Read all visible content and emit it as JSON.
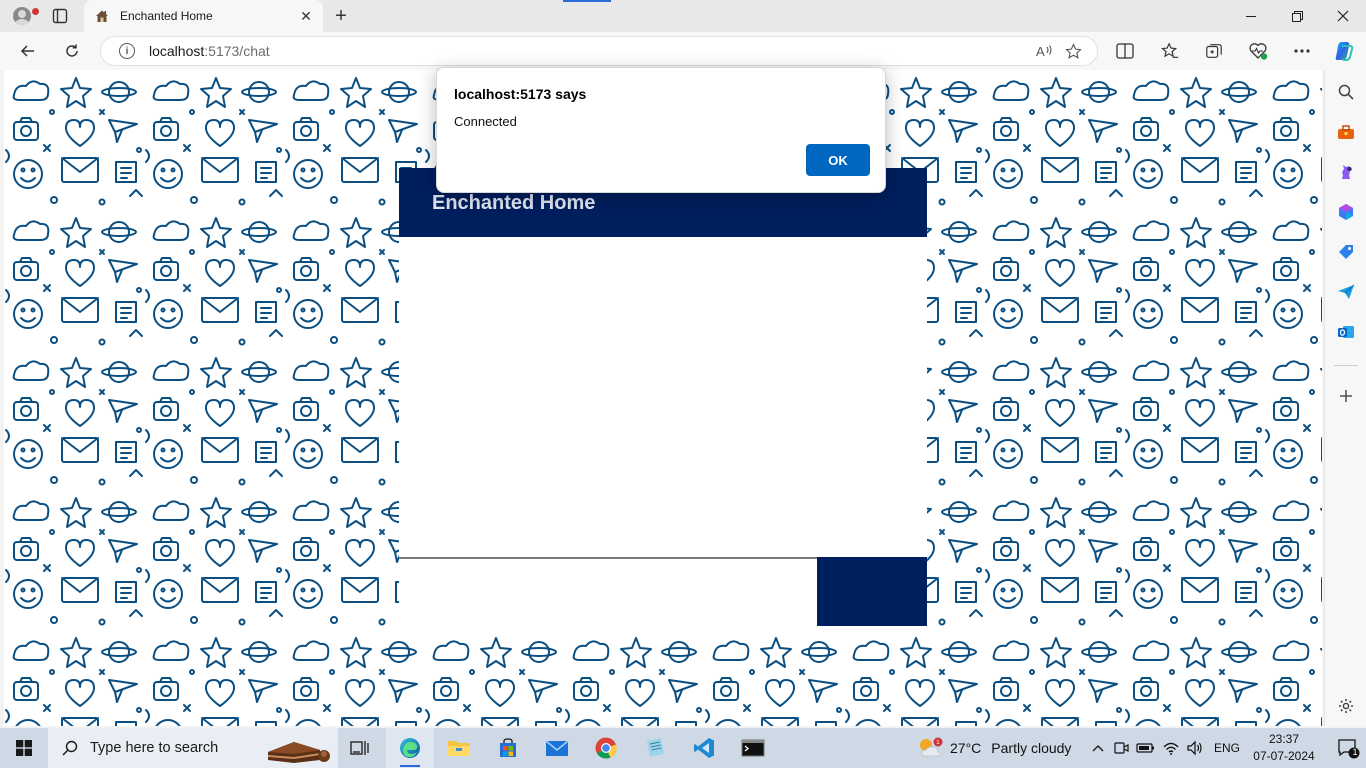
{
  "browser": {
    "tab_title": "Enchanted Home",
    "url_host": "localhost",
    "url_path": ":5173/chat"
  },
  "page": {
    "chat_title": "Enchanted Home"
  },
  "alert": {
    "title": "localhost:5173 says",
    "message": "Connected",
    "ok_label": "OK"
  },
  "taskbar": {
    "search_placeholder": "Type here to search",
    "weather_temp": "27°C",
    "weather_desc": "Partly cloudy",
    "language": "ENG",
    "time": "23:37",
    "date": "07-07-2024",
    "notification_count": "1"
  },
  "colors": {
    "brand_navy": "#001f5f",
    "doodle_blue": "#0b4f82",
    "edge_blue": "#0067c0"
  }
}
